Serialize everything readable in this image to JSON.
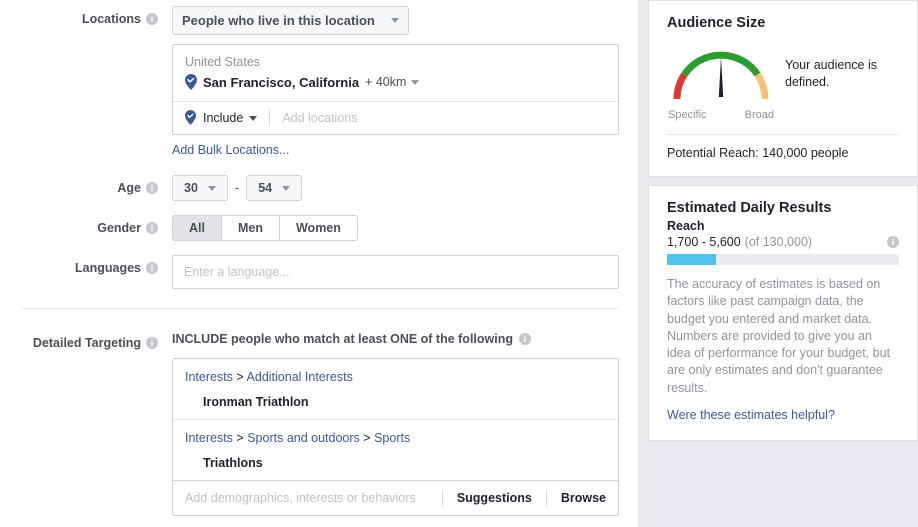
{
  "form": {
    "locations": {
      "label": "Locations",
      "dropdown_value": "People who live in this location",
      "country": "United States",
      "city": "San Francisco, California",
      "radius": "+ 40km",
      "include_label": "Include",
      "add_locations_placeholder": "Add locations",
      "bulk_link": "Add Bulk Locations..."
    },
    "age": {
      "label": "Age",
      "min": "30",
      "max": "54",
      "dash": "-"
    },
    "gender": {
      "label": "Gender",
      "options": [
        {
          "label": "All",
          "selected": true
        },
        {
          "label": "Men",
          "selected": false
        },
        {
          "label": "Women",
          "selected": false
        }
      ]
    },
    "languages": {
      "label": "Languages",
      "placeholder": "Enter a language...",
      "value": ""
    },
    "detailed_targeting": {
      "label": "Detailed Targeting",
      "caption": "INCLUDE people who match at least ONE of the following",
      "groups": [
        {
          "crumb": [
            "Interests",
            "Additional Interests"
          ],
          "item": "Ironman Triathlon"
        },
        {
          "crumb": [
            "Interests",
            "Sports and outdoors",
            "Sports"
          ],
          "item": "Triathlons"
        }
      ],
      "input_placeholder": "Add demographics, interests or behaviors",
      "suggestions_label": "Suggestions",
      "browse_label": "Browse"
    }
  },
  "audience_size": {
    "title": "Audience Size",
    "gauge": {
      "specific_label": "Specific",
      "broad_label": "Broad",
      "needle_position_pct": 50,
      "arc_colors": {
        "specific": "#d93b30",
        "defined": "#2a9d2f",
        "broad": "#f5c277"
      }
    },
    "message": "Your audience is defined.",
    "potential_reach": "Potential Reach: 140,000 people"
  },
  "estimated_daily_results": {
    "title": "Estimated Daily Results",
    "reach_label": "Reach",
    "reach_range": "1,700 - 5,600",
    "reach_total": "(of 130,000)",
    "bar_fill_pct": 21,
    "bar_fill_color": "#4fc3ec",
    "note": "The accuracy of estimates is based on factors like past campaign data, the budget you entered and market data. Numbers are provided to give you an idea of performance for your budget, but are only estimates and don't guarantee results.",
    "feedback_link": "Were these estimates helpful?"
  },
  "icons": {
    "info": "i"
  }
}
